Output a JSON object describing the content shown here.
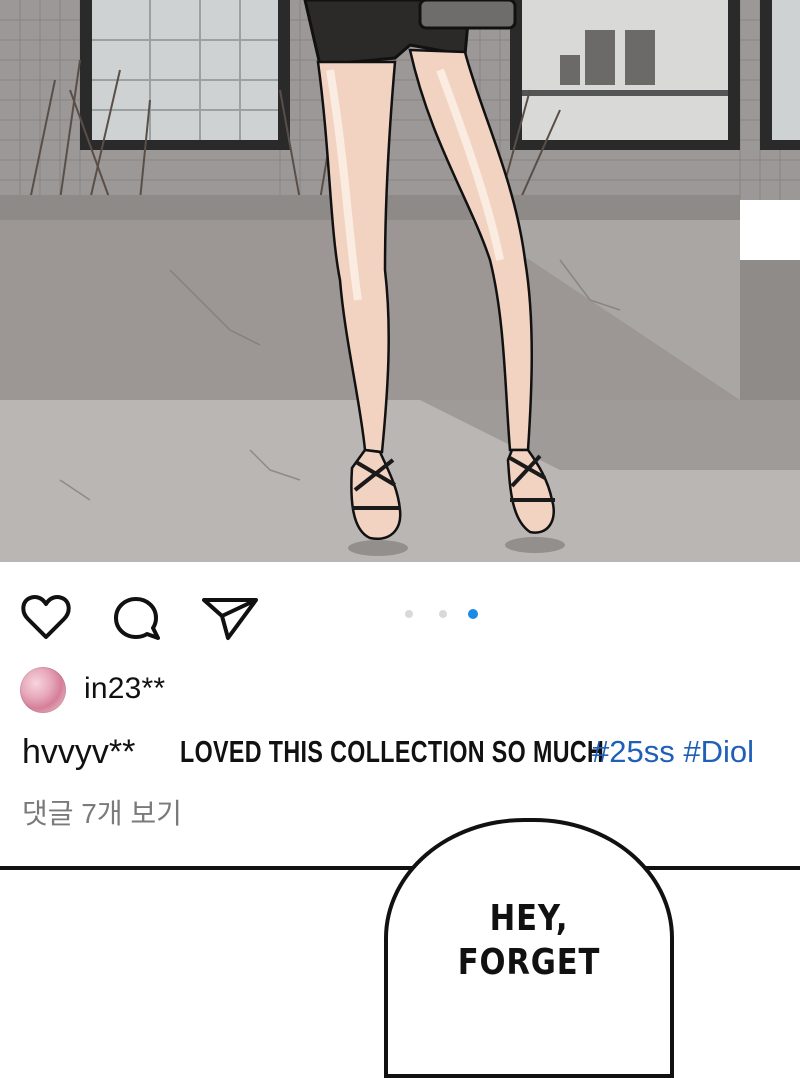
{
  "post": {
    "username": "in23**",
    "caption_user": "hvvyv**",
    "caption_text": "LOVED THIS COLLECTION SO MUCH",
    "hashtags": "#25ss #Diol",
    "comments_link": "댓글 7개 보기"
  },
  "actions": {
    "like_icon": "heart-icon",
    "comment_icon": "comment-icon",
    "share_icon": "share-icon"
  },
  "carousel": {
    "count": 3,
    "active": 3
  },
  "speech_bubble": {
    "line1": "HEY,",
    "line2": "FORGET"
  },
  "colors": {
    "hashtag": "#1f5fb8",
    "active_dot": "#1a8ae6",
    "inactive_dot": "#d9d9d9",
    "comments_text": "#7a7a7a"
  }
}
